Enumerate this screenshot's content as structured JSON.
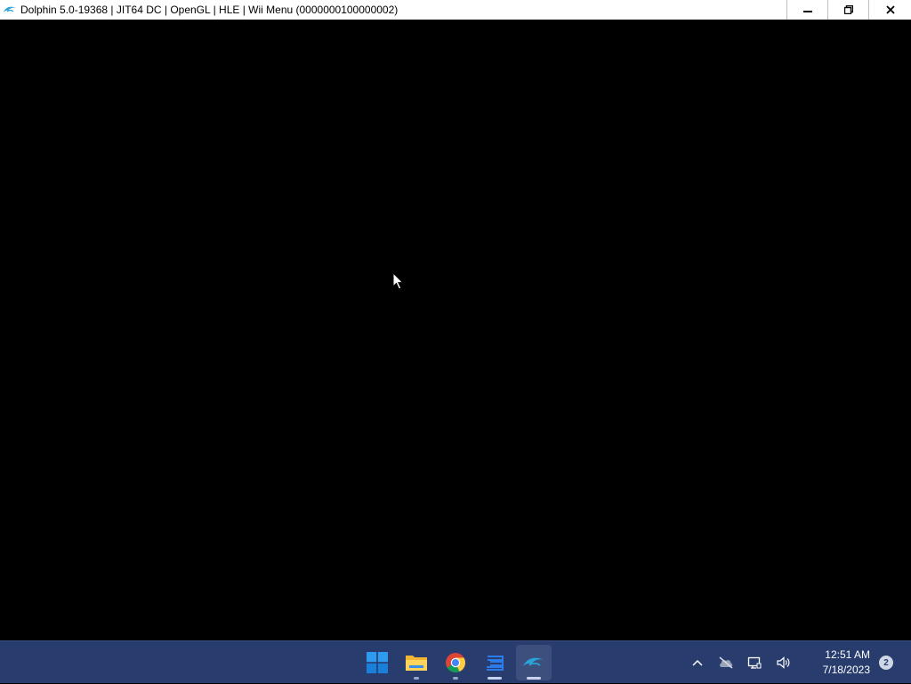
{
  "window": {
    "title": "Dolphin 5.0-19368 | JIT64 DC | OpenGL | HLE | Wii Menu (0000000100000002)",
    "app_icon": "dolphin-icon",
    "controls": [
      "minimize-icon",
      "restore-icon",
      "close-icon"
    ]
  },
  "taskbar": {
    "background": "#283c6e",
    "apps": [
      {
        "name": "start",
        "icon": "windows-logo-icon"
      },
      {
        "name": "file-explorer",
        "icon": "folder-icon"
      },
      {
        "name": "chrome",
        "icon": "chrome-icon"
      },
      {
        "name": "app",
        "icon": "app-icon"
      },
      {
        "name": "dolphin",
        "icon": "dolphin-icon",
        "active": true
      }
    ],
    "tray": {
      "icons": [
        "chevron-up-icon",
        "cloud-offline-icon",
        "network-icon",
        "volume-icon"
      ],
      "time": "12:51 AM",
      "date": "7/18/2023",
      "notification_count": "2"
    }
  }
}
